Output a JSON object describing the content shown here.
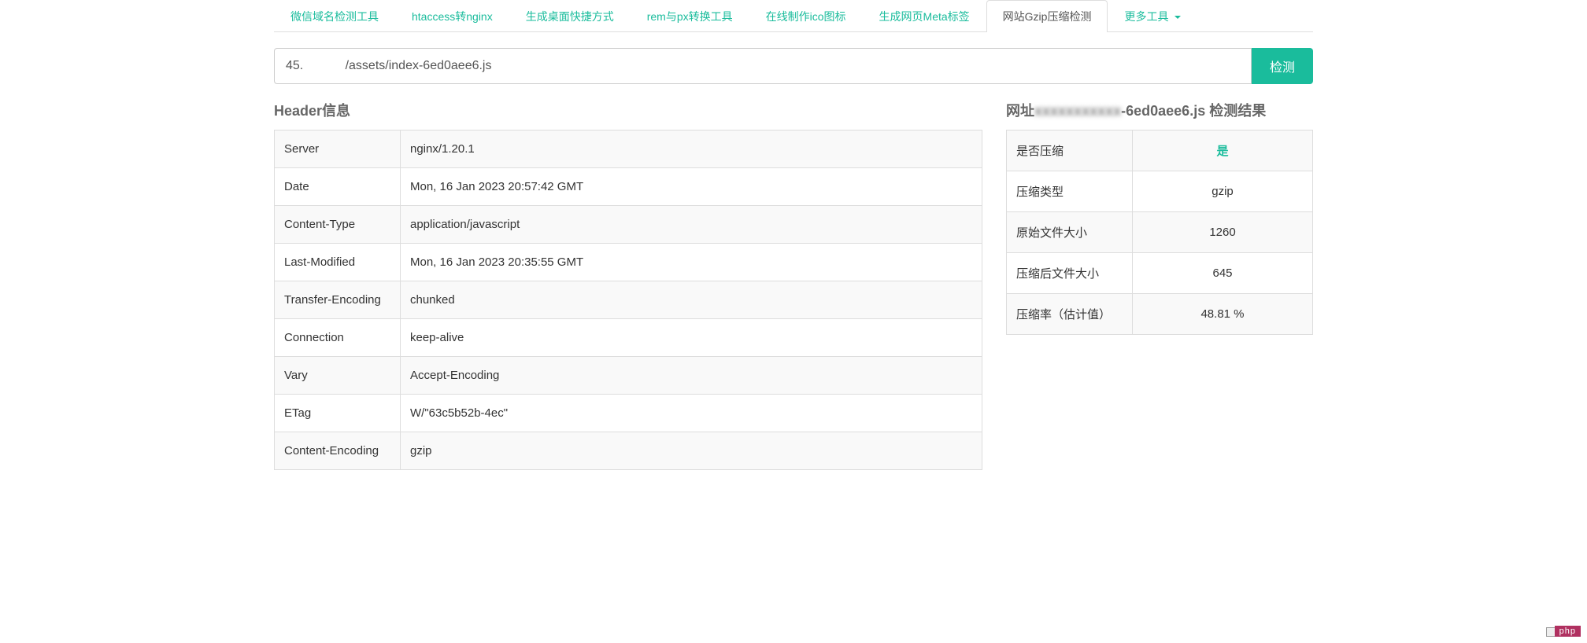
{
  "tabs": {
    "items": [
      "微信域名检测工具",
      "htaccess转nginx",
      "生成桌面快捷方式",
      "rem与px转换工具",
      "在线制作ico图标",
      "生成网页Meta标签",
      "网站Gzip压缩检测"
    ],
    "more_label": "更多工具",
    "active_index": 6
  },
  "search": {
    "value_redacted_prefix": "45.",
    "value_visible_suffix": "/assets/index-6ed0aee6.js",
    "button_label": "检测"
  },
  "header_section": {
    "title": "Header信息",
    "rows": [
      {
        "key": "Server",
        "value": "nginx/1.20.1"
      },
      {
        "key": "Date",
        "value": "Mon, 16 Jan 2023 20:57:42 GMT"
      },
      {
        "key": "Content-Type",
        "value": "application/javascript"
      },
      {
        "key": "Last-Modified",
        "value": "Mon, 16 Jan 2023 20:35:55 GMT"
      },
      {
        "key": "Transfer-Encoding",
        "value": "chunked"
      },
      {
        "key": "Connection",
        "value": "keep-alive"
      },
      {
        "key": "Vary",
        "value": "Accept-Encoding"
      },
      {
        "key": "ETag",
        "value": "W/\"63c5b52b-4ec\""
      },
      {
        "key": "Content-Encoding",
        "value": "gzip"
      }
    ]
  },
  "result_section": {
    "title_prefix": "网址",
    "title_redacted_middle": " ",
    "title_suffix": "-6ed0aee6.js 检测结果",
    "rows": [
      {
        "key": "是否压缩",
        "value": "是",
        "highlight": true
      },
      {
        "key": "压缩类型",
        "value": "gzip",
        "highlight": false
      },
      {
        "key": "原始文件大小",
        "value": "1260",
        "highlight": false
      },
      {
        "key": "压缩后文件大小",
        "value": "645",
        "highlight": false
      },
      {
        "key": "压缩率（估计值）",
        "value": "48.81 %",
        "highlight": false
      }
    ]
  },
  "watermark": "php"
}
